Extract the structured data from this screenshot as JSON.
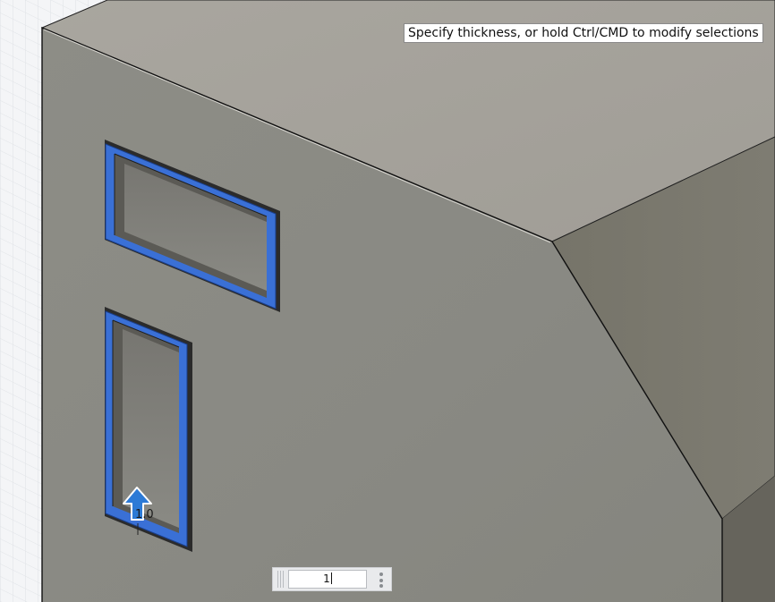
{
  "viewport": {
    "tooltip": "Specify thickness, or hold Ctrl/CMD to modify selections",
    "manipulator_value": "1.0",
    "selection_color": "#3a70d6",
    "arrow_color": "#2c7ad6"
  },
  "dimension_input": {
    "value": "1",
    "menu_icon": "vertical-ellipsis-icon"
  },
  "colors": {
    "background": "#f4f5f7",
    "grid": "#dfe2e6",
    "top_face": "#a4a19b",
    "front_face": "#898982",
    "chamfer_face": "#7b7970",
    "edge": "#111111"
  }
}
